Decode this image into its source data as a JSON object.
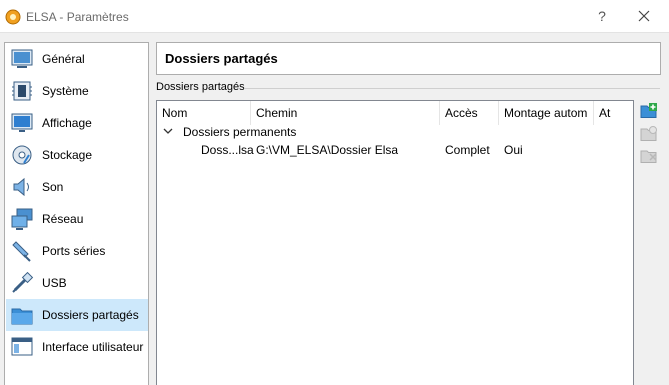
{
  "window": {
    "title": "ELSA - Paramètres",
    "help_label": "?"
  },
  "sidebar": {
    "items": [
      {
        "label": "Général",
        "icon": "general-icon"
      },
      {
        "label": "Système",
        "icon": "system-icon"
      },
      {
        "label": "Affichage",
        "icon": "display-icon"
      },
      {
        "label": "Stockage",
        "icon": "storage-icon"
      },
      {
        "label": "Son",
        "icon": "audio-icon"
      },
      {
        "label": "Réseau",
        "icon": "network-icon"
      },
      {
        "label": "Ports séries",
        "icon": "serial-ports-icon"
      },
      {
        "label": "USB",
        "icon": "usb-icon"
      },
      {
        "label": "Dossiers partagés",
        "icon": "shared-folders-icon",
        "selected": true
      },
      {
        "label": "Interface utilisateur",
        "icon": "user-interface-icon"
      }
    ]
  },
  "page": {
    "title": "Dossiers partagés",
    "group_label": "Dossiers partagés"
  },
  "table": {
    "columns": [
      "Nom",
      "Chemin",
      "Accès",
      "Montage autom",
      "At"
    ],
    "group": "Dossiers permanents",
    "rows": [
      {
        "name": "Doss...lsa",
        "path": "G:\\VM_ELSA\\Dossier Elsa",
        "access": "Complet",
        "automount": "Oui",
        "at": ""
      }
    ]
  },
  "actions": [
    "add-shared-folder-icon",
    "edit-shared-folder-icon",
    "remove-shared-folder-icon"
  ],
  "colors": {
    "selection": "#cde8fb",
    "accent_green": "#2ea84a",
    "accent_blue": "#3b8fd6"
  }
}
